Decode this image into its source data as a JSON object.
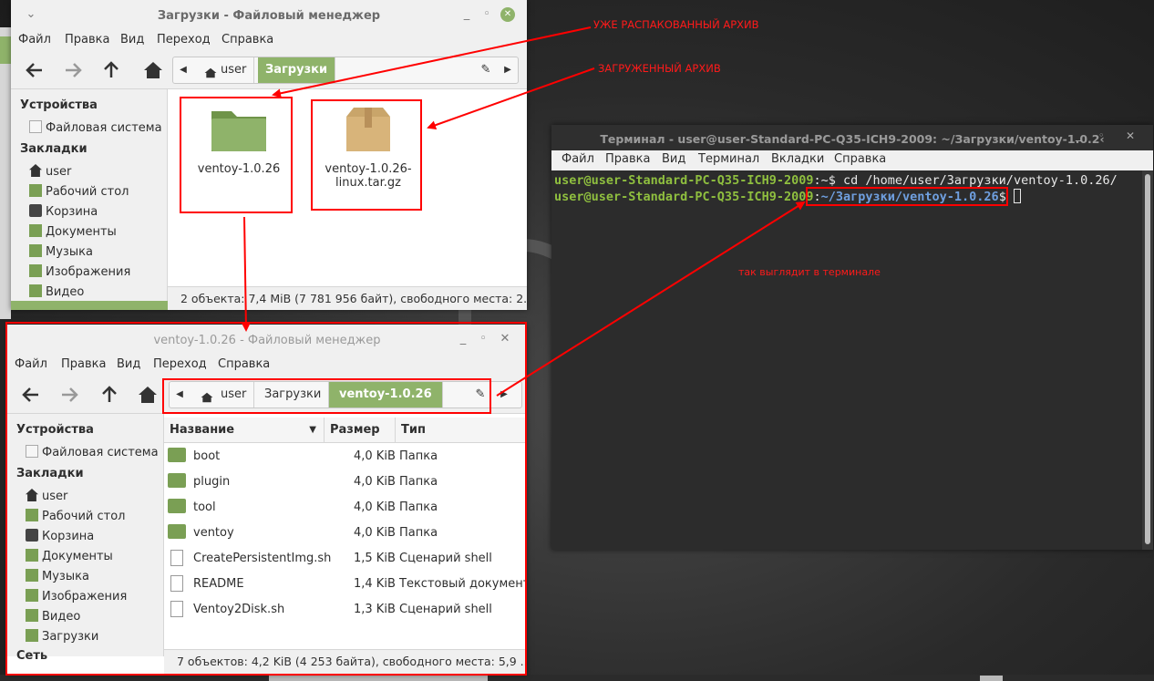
{
  "colors": {
    "accent": "#8fb36a",
    "folder": "#7a9f54",
    "annotation": "#ff0000",
    "term_green": "#8fbf3f",
    "term_blue": "#6f9fdf"
  },
  "fm1": {
    "title": "Загрузки - Файловый менеджер",
    "menu": [
      "Файл",
      "Правка",
      "Вид",
      "Переход",
      "Справка"
    ],
    "path": [
      "user",
      "Загрузки"
    ],
    "sidebar": {
      "devices_header": "Устройства",
      "filesystem": "Файловая система",
      "bookmarks_header": "Закладки",
      "bookmarks": [
        "user",
        "Рабочий стол",
        "Корзина",
        "Документы",
        "Музыка",
        "Изображения",
        "Видео"
      ]
    },
    "items": [
      {
        "name": "ventoy-1.0.26",
        "icon": "folder-icon"
      },
      {
        "name": "ventoy-1.0.26-linux.tar.gz",
        "name_line1": "ventoy-1.0.26-",
        "name_line2": "linux.tar.gz",
        "icon": "archive-icon"
      }
    ],
    "status": "2 объекта: 7,4 MiB (7 781 956 байт), свободного места: 2..."
  },
  "fm2": {
    "title": "ventoy-1.0.26 - Файловый менеджер",
    "menu": [
      "Файл",
      "Правка",
      "Вид",
      "Переход",
      "Справка"
    ],
    "path": [
      "user",
      "Загрузки",
      "ventoy-1.0.26"
    ],
    "sidebar": {
      "devices_header": "Устройства",
      "filesystem": "Файловая система",
      "bookmarks_header": "Закладки",
      "bookmarks": [
        "user",
        "Рабочий стол",
        "Корзина",
        "Документы",
        "Музыка",
        "Изображения",
        "Видео",
        "Загрузки"
      ],
      "network_header": "Сеть"
    },
    "columns": [
      "Название",
      "Размер",
      "Тип"
    ],
    "rows": [
      {
        "name": "boot",
        "size": "4,0 KiB",
        "type": "Папка",
        "icon": "folder-icon"
      },
      {
        "name": "plugin",
        "size": "4,0 KiB",
        "type": "Папка",
        "icon": "folder-icon"
      },
      {
        "name": "tool",
        "size": "4,0 KiB",
        "type": "Папка",
        "icon": "folder-icon"
      },
      {
        "name": "ventoy",
        "size": "4,0 KiB",
        "type": "Папка",
        "icon": "folder-icon"
      },
      {
        "name": "CreatePersistentImg.sh",
        "size": "1,5 KiB",
        "type": "Сценарий shell",
        "icon": "script-icon"
      },
      {
        "name": "README",
        "size": "1,4 KiB",
        "type": "Текстовый документ",
        "icon": "text-file-icon"
      },
      {
        "name": "Ventoy2Disk.sh",
        "size": "1,3 KiB",
        "type": "Сценарий shell",
        "icon": "script-icon"
      }
    ],
    "status": "7 объектов: 4,2 KiB (4 253 байта), свободного места: 5,9 ..."
  },
  "terminal": {
    "title": "Терминал - user@user-Standard-PC-Q35-ICH9-2009: ~/Загрузки/ventoy-1.0.2‹",
    "menu": [
      "Файл",
      "Правка",
      "Вид",
      "Терминал",
      "Вкладки",
      "Справка"
    ],
    "line1_prompt": "user@user-Standard-PC-Q35-ICH9-2009",
    "line1_path": ":~$",
    "line1_cmd": " cd /home/user/Загрузки/ventoy-1.0.26/",
    "line2_prompt": "user@user-Standard-PC-Q35-ICH9-2009",
    "line2_sep": ":",
    "line2_path": "~/Загрузки/ventoy-1.0.26",
    "line2_end": "$ "
  },
  "annotations": {
    "unpacked": "УЖЕ РАСПАКОВАННЫЙ АРХИВ",
    "downloaded": "ЗАГРУЖЕННЫЙ АРХИВ",
    "terminal_note": "так выглядит в терминале"
  }
}
